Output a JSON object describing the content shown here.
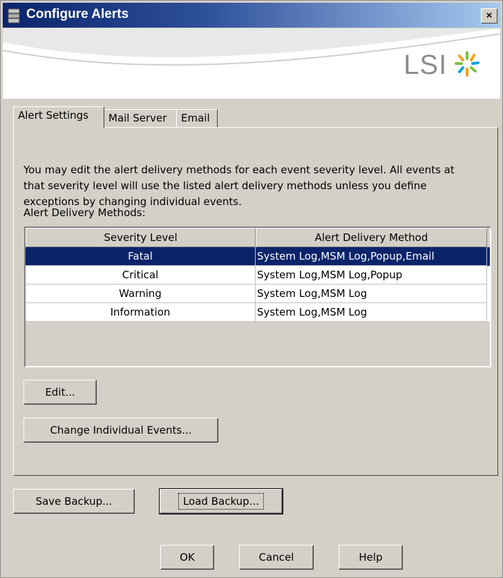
{
  "window": {
    "title": "Configure Alerts",
    "close_label": "×"
  },
  "banner": {
    "logo_text": "LSI"
  },
  "tabs": [
    {
      "label": "Alert Settings"
    },
    {
      "label": "Mail Server"
    },
    {
      "label": "Email"
    }
  ],
  "alert_settings": {
    "description": "You may edit the alert delivery methods for each event severity level. All events at that severity level will use the listed alert delivery methods unless you define exceptions by changing individual events.",
    "methods_label": "Alert Delivery Methods:",
    "columns": [
      "Severity Level",
      "Alert Delivery Method"
    ],
    "rows": [
      {
        "severity": "Fatal",
        "method": "System Log,MSM Log,Popup,Email",
        "selected": true
      },
      {
        "severity": "Critical",
        "method": "System Log,MSM Log,Popup"
      },
      {
        "severity": "Warning",
        "method": "System Log,MSM Log"
      },
      {
        "severity": "Information",
        "method": "System Log,MSM Log"
      }
    ],
    "edit_label": "Edit...",
    "change_events_label": "Change Individual Events..."
  },
  "footer": {
    "save_backup": "Save Backup...",
    "load_backup": "Load Backup...",
    "ok": "OK",
    "cancel": "Cancel",
    "help": "Help"
  },
  "colors": {
    "selection": "#0a246a",
    "titlebar": "#0a246a",
    "face": "#d4d0c8"
  }
}
